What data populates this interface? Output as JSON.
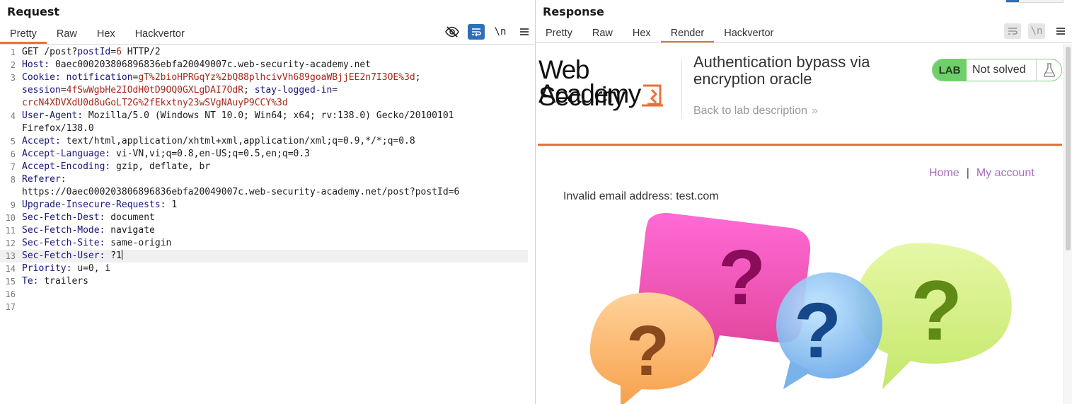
{
  "request": {
    "title": "Request",
    "tabs": [
      "Pretty",
      "Raw",
      "Hex",
      "Hackvertor"
    ],
    "active_tab": "Pretty",
    "toolbar_icons": [
      "hide-icon",
      "wrap-icon",
      "newline-icon",
      "menu-icon"
    ],
    "newline_label": "\\n",
    "lines": [
      {
        "n": "1",
        "parts": [
          [
            "t",
            "GET /post?"
          ],
          [
            "pk",
            "postId"
          ],
          [
            "t",
            "="
          ],
          [
            "cv",
            "6"
          ],
          [
            "t",
            " HTTP/2"
          ]
        ]
      },
      {
        "n": "2",
        "parts": [
          [
            "hk",
            "Host:"
          ],
          [
            "t",
            " 0aec000203806896836ebfa20049007c.web-security-academy.net"
          ]
        ]
      },
      {
        "n": "3",
        "parts": [
          [
            "hk",
            "Cookie:"
          ],
          [
            "t",
            " "
          ],
          [
            "hk",
            "notification"
          ],
          [
            "t",
            "="
          ],
          [
            "cv",
            "gT%2bioHPRGqYz%2bQ88plhcivVh689goaWBjjEE2n7I3OE%3d"
          ],
          [
            "t",
            ";"
          ]
        ]
      },
      {
        "n": "",
        "parts": [
          [
            "hk",
            "session"
          ],
          [
            "t",
            "="
          ],
          [
            "cv",
            "4fSwWgbHe2IOdH0tD9OQ0GXLgDAI7OdR"
          ],
          [
            "t",
            "; "
          ],
          [
            "hk",
            "stay-logged-in"
          ],
          [
            "t",
            "="
          ]
        ]
      },
      {
        "n": "",
        "parts": [
          [
            "cv",
            "crcN4XDVXdU0d8uGoLT2G%2fEkxtny23wSVgNAuyP9CCY%3d"
          ]
        ]
      },
      {
        "n": "4",
        "parts": [
          [
            "hk",
            "User-Agent:"
          ],
          [
            "t",
            " Mozilla/5.0 (Windows NT 10.0; Win64; x64; rv:138.0) Gecko/20100101"
          ]
        ]
      },
      {
        "n": "",
        "parts": [
          [
            "t",
            "Firefox/138.0"
          ]
        ]
      },
      {
        "n": "5",
        "parts": [
          [
            "hk",
            "Accept:"
          ],
          [
            "t",
            " text/html,application/xhtml+xml,application/xml;q=0.9,*/*;q=0.8"
          ]
        ]
      },
      {
        "n": "6",
        "parts": [
          [
            "hk",
            "Accept-Language:"
          ],
          [
            "t",
            " vi-VN,vi;q=0.8,en-US;q=0.5,en;q=0.3"
          ]
        ]
      },
      {
        "n": "7",
        "parts": [
          [
            "hk",
            "Accept-Encoding:"
          ],
          [
            "t",
            " gzip, deflate, br"
          ]
        ]
      },
      {
        "n": "8",
        "parts": [
          [
            "hk",
            "Referer:"
          ]
        ]
      },
      {
        "n": "",
        "parts": [
          [
            "t",
            "https://0aec000203806896836ebfa20049007c.web-security-academy.net/post?postId=6"
          ]
        ]
      },
      {
        "n": "9",
        "parts": [
          [
            "hk",
            "Upgrade-Insecure-Requests:"
          ],
          [
            "t",
            " 1"
          ]
        ]
      },
      {
        "n": "10",
        "parts": [
          [
            "hk",
            "Sec-Fetch-Dest:"
          ],
          [
            "t",
            " document"
          ]
        ]
      },
      {
        "n": "11",
        "parts": [
          [
            "hk",
            "Sec-Fetch-Mode:"
          ],
          [
            "t",
            " navigate"
          ]
        ]
      },
      {
        "n": "12",
        "parts": [
          [
            "hk",
            "Sec-Fetch-Site:"
          ],
          [
            "t",
            " same-origin"
          ]
        ]
      },
      {
        "n": "13",
        "parts": [
          [
            "hk",
            "Sec-Fetch-User:"
          ],
          [
            "t",
            " ?1"
          ]
        ],
        "highlight": true
      },
      {
        "n": "14",
        "parts": [
          [
            "hk",
            "Priority:"
          ],
          [
            "t",
            " u=0, i"
          ]
        ]
      },
      {
        "n": "15",
        "parts": [
          [
            "hk",
            "Te:"
          ],
          [
            "t",
            " trailers"
          ]
        ]
      },
      {
        "n": "16",
        "parts": []
      },
      {
        "n": "17",
        "parts": []
      }
    ]
  },
  "response": {
    "title": "Response",
    "tabs": [
      "Pretty",
      "Raw",
      "Hex",
      "Render",
      "Hackvertor"
    ],
    "active_tab": "Render",
    "newline_label": "\\n",
    "page": {
      "logo_line1": "Web Security",
      "logo_line2": "Academy",
      "lab_title": "Authentication bypass via encryption oracle",
      "back_link": "Back to lab description",
      "back_chevron": "»",
      "badge_label": "LAB",
      "badge_status": "Not solved",
      "nav_home": "Home",
      "nav_sep": "|",
      "nav_account": "My account",
      "message": "Invalid email address: test.com"
    }
  },
  "colors": {
    "accent_orange": "#e8713a",
    "header_key": "#17147a",
    "cookie_value": "#a8271a",
    "nav_link": "#a76dbf",
    "lab_green": "#6fcf6a"
  }
}
